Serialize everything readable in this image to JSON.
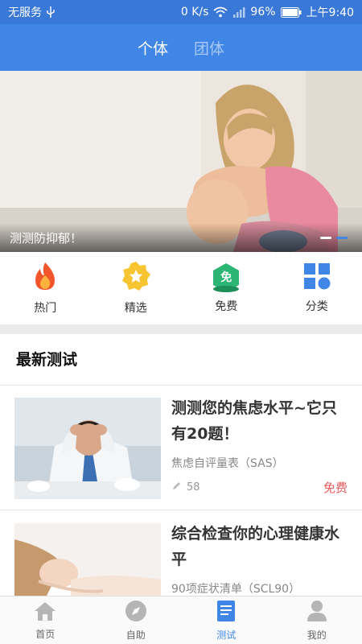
{
  "status_bar": {
    "carrier": "无服务",
    "speed": "0 K/s",
    "battery": "96%",
    "time": "上午9:40"
  },
  "header": {
    "tabs": [
      {
        "label": "个体",
        "active": true
      },
      {
        "label": "团体",
        "active": false
      }
    ]
  },
  "banner": {
    "caption": "测测防抑郁！",
    "slide_count": 2,
    "active_slide": 2
  },
  "quick_nav": [
    {
      "label": "热门",
      "icon": "flame-icon"
    },
    {
      "label": "精选",
      "icon": "star-badge-icon"
    },
    {
      "label": "免费",
      "icon": "free-badge-icon",
      "badge_text": "免"
    },
    {
      "label": "分类",
      "icon": "category-grid-icon"
    }
  ],
  "section": {
    "title": "最新测试"
  },
  "tests": [
    {
      "title": "测测您的焦虑水平~它只有20题！",
      "subtitle": "焦虑自评量表（SAS）",
      "count": "58",
      "price": "免费",
      "image": "stressed-man-photo"
    },
    {
      "title": "综合检查你的心理健康水平",
      "subtitle": "90项症状清单（SCL90）",
      "image": "sleeping-woman-photo"
    }
  ],
  "bottom_nav": [
    {
      "label": "首页",
      "icon": "home-icon",
      "active": false
    },
    {
      "label": "自助",
      "icon": "compass-icon",
      "active": false
    },
    {
      "label": "测试",
      "icon": "book-icon",
      "active": true
    },
    {
      "label": "我的",
      "icon": "user-icon",
      "active": false
    }
  ],
  "colors": {
    "primary": "#3f86e6",
    "price": "#e85a5a"
  }
}
